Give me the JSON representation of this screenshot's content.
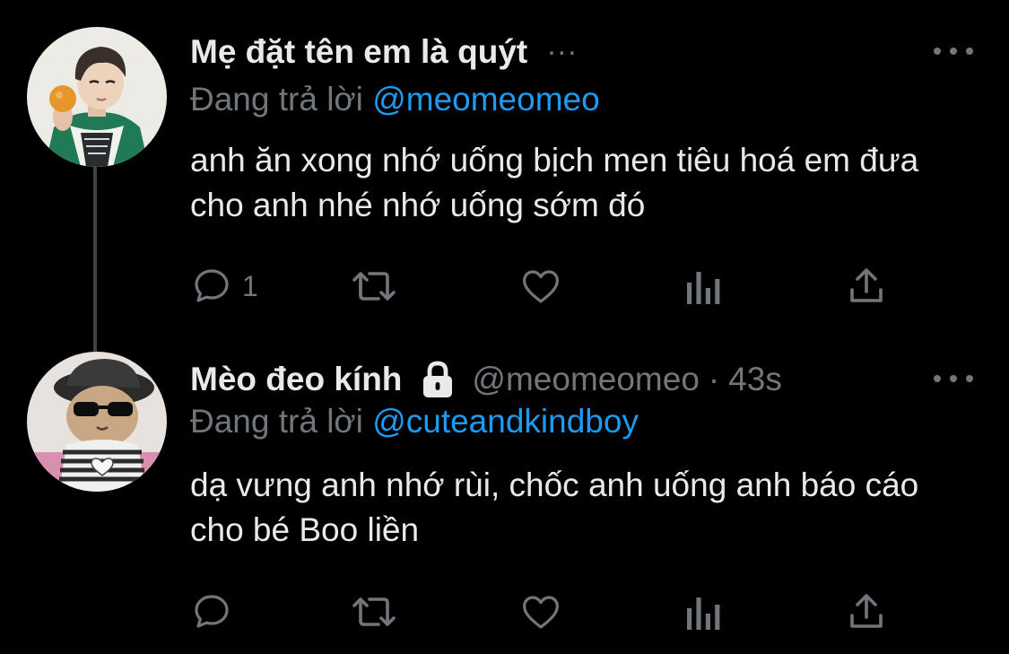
{
  "tweets": [
    {
      "display_name": "Mẹ đặt tên em là quýt",
      "name_overflow": "...",
      "reply_prefix": "Đang trả lời",
      "reply_to": "@meomeomeo",
      "text": "anh ăn xong nhớ uống bịch men tiêu hoá em đưa cho anh nhé nhớ uống sớm đó",
      "reply_count": "1",
      "avatar_icon": "avatar-boy-with-orange"
    },
    {
      "display_name": "Mèo đeo kính",
      "protected_icon": "lock-icon",
      "handle": "@meomeomeo",
      "separator": "·",
      "time": "43s",
      "reply_prefix": "Đang trả lời",
      "reply_to": "@cuteandkindboy",
      "text": "dạ vưng anh nhớ rùi, chốc anh uống anh báo cáo cho bé Boo liền",
      "reply_count": "",
      "avatar_icon": "avatar-cat-with-sunglasses"
    }
  ],
  "theme": {
    "background": "#000000",
    "text": "#e7e9ea",
    "muted": "#71767b",
    "accent": "#1d9bf0",
    "thread_line": "#3f4347"
  }
}
